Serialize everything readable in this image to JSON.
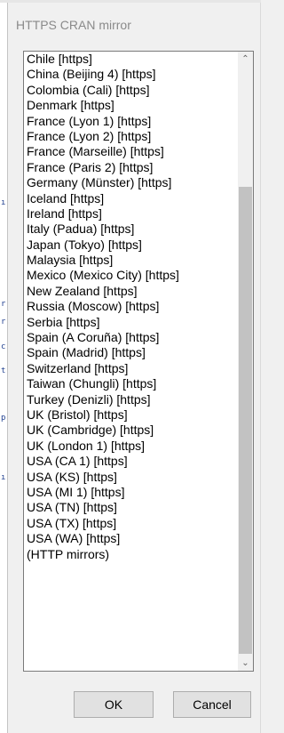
{
  "dialog": {
    "title": "HTTPS CRAN mirror",
    "ok_label": "OK",
    "cancel_label": "Cancel"
  },
  "mirrors": [
    "Chile [https]",
    "China (Beijing 4) [https]",
    "Colombia (Cali) [https]",
    "Denmark [https]",
    "France (Lyon 1) [https]",
    "France (Lyon 2) [https]",
    "France (Marseille) [https]",
    "France (Paris 2) [https]",
    "Germany (Münster) [https]",
    "Iceland [https]",
    "Ireland [https]",
    "Italy (Padua) [https]",
    "Japan (Tokyo) [https]",
    "Malaysia [https]",
    "Mexico (Mexico City) [https]",
    "New Zealand [https]",
    "Russia (Moscow) [https]",
    "Serbia [https]",
    "Spain (A Coruña) [https]",
    "Spain (Madrid) [https]",
    "Switzerland [https]",
    "Taiwan (Chungli) [https]",
    "Turkey (Denizli) [https]",
    "UK (Bristol) [https]",
    "UK (Cambridge) [https]",
    "UK (London 1) [https]",
    "USA (CA 1) [https]",
    "USA (KS) [https]",
    "USA (MI 1) [https]",
    "USA (TN) [https]",
    "USA (TX) [https]",
    "USA (WA) [https]",
    "(HTTP mirrors)"
  ],
  "background_marks": [
    "i",
    "r",
    "r",
    "c",
    "t",
    "p",
    "i"
  ],
  "colors": {
    "background": "#f0f0f0",
    "title_text": "#8a8a8a",
    "scrollbar_thumb": "#c2c2c2",
    "button_face": "#e1e1e1"
  },
  "icons": {
    "scroll_up": "chevron-up-icon",
    "scroll_down": "chevron-down-icon"
  }
}
